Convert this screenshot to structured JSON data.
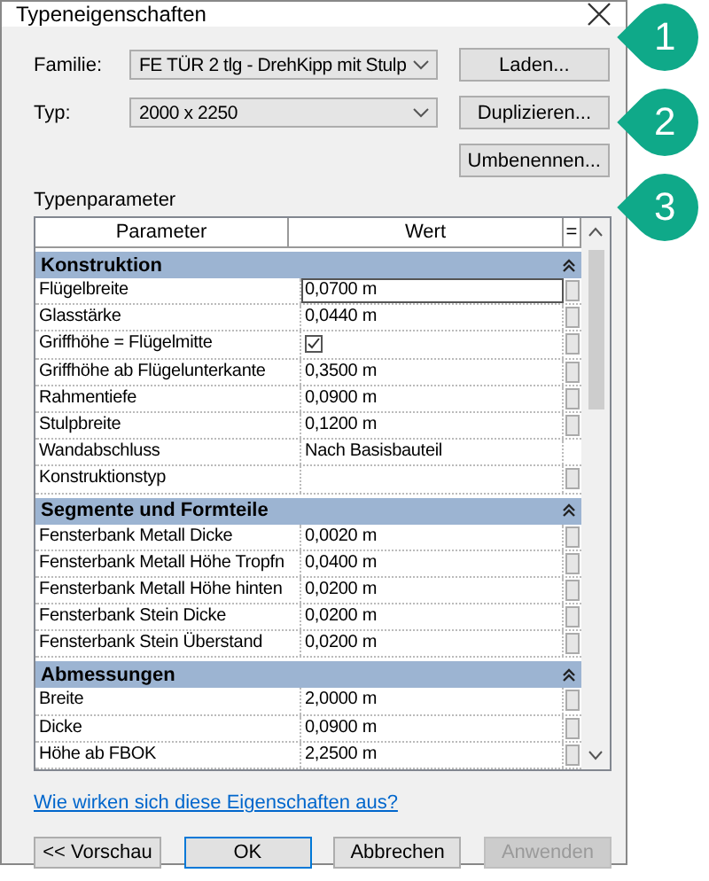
{
  "window": {
    "title": "Typeneigenschaften"
  },
  "family": {
    "label": "Familie:",
    "value": "FE TÜR 2 tlg - DrehKipp mit Stulp"
  },
  "type": {
    "label": "Typ:",
    "value": "2000 x 2250"
  },
  "side_buttons": [
    "Laden...",
    "Duplizieren...",
    "Umbenennen..."
  ],
  "section_label": "Typenparameter",
  "table": {
    "columns": [
      "Parameter",
      "Wert",
      "="
    ],
    "groups": [
      {
        "title": "Konstruktion",
        "expanded": true,
        "rows": [
          {
            "kind": "text",
            "name": "Flügelbreite",
            "value": "0,0700 m",
            "selected": true,
            "has_button": true
          },
          {
            "kind": "text",
            "name": "Glasstärke",
            "value": "0,0440 m",
            "selected": false,
            "has_button": true
          },
          {
            "kind": "checkbox",
            "name": "Griffhöhe = Flügelmitte",
            "checked": true,
            "selected": false,
            "has_button": true
          },
          {
            "kind": "text",
            "name": "Griffhöhe ab Flügelunterkante",
            "value": "0,3500 m",
            "selected": false,
            "has_button": true
          },
          {
            "kind": "text",
            "name": "Rahmentiefe",
            "value": "0,0900 m",
            "selected": false,
            "has_button": true
          },
          {
            "kind": "text",
            "name": "Stulpbreite",
            "value": "0,1200 m",
            "selected": false,
            "has_button": true
          },
          {
            "kind": "text",
            "name": "Wandabschluss",
            "value": "Nach Basisbauteil",
            "selected": false,
            "has_button": false
          },
          {
            "kind": "text",
            "name": "Konstruktionstyp",
            "selected": false,
            "has_button": true
          }
        ]
      },
      {
        "title": "Segmente und Formteile",
        "expanded": true,
        "rows": [
          {
            "kind": "text",
            "name": "Fensterbank Metall Dicke",
            "value": "0,0020 m",
            "selected": false,
            "has_button": true
          },
          {
            "kind": "text",
            "name": "Fensterbank Metall Höhe Tropfn",
            "value": "0,0400 m",
            "selected": false,
            "has_button": true
          },
          {
            "kind": "text",
            "name": "Fensterbank Metall Höhe hinten",
            "value": "0,0200 m",
            "selected": false,
            "has_button": true
          },
          {
            "kind": "text",
            "name": "Fensterbank Stein Dicke",
            "value": "0,0200 m",
            "selected": false,
            "has_button": true
          },
          {
            "kind": "text",
            "name": "Fensterbank Stein Überstand",
            "value": "0,0200 m",
            "selected": false,
            "has_button": true
          }
        ]
      },
      {
        "title": "Abmessungen",
        "expanded": true,
        "rows": [
          {
            "kind": "text",
            "name": "Breite",
            "value": "2,0000 m",
            "selected": false,
            "has_button": true
          },
          {
            "kind": "text",
            "name": "Dicke",
            "value": "0,0900 m",
            "selected": false,
            "has_button": true
          },
          {
            "kind": "text",
            "name": "Höhe ab FBOK",
            "value": "2,2500 m",
            "selected": false,
            "has_button": true
          }
        ]
      }
    ]
  },
  "help_link": "Wie wirken sich diese Eigenschaften aus?",
  "footer_buttons": [
    {
      "label": "<< Vorschau",
      "disabled": false,
      "default": false
    },
    {
      "label": "OK",
      "disabled": false,
      "default": true
    },
    {
      "label": "Abbrechen",
      "disabled": false,
      "default": false
    },
    {
      "label": "Anwenden",
      "disabled": true,
      "default": false
    }
  ],
  "callouts": [
    "1",
    "2",
    "3"
  ]
}
